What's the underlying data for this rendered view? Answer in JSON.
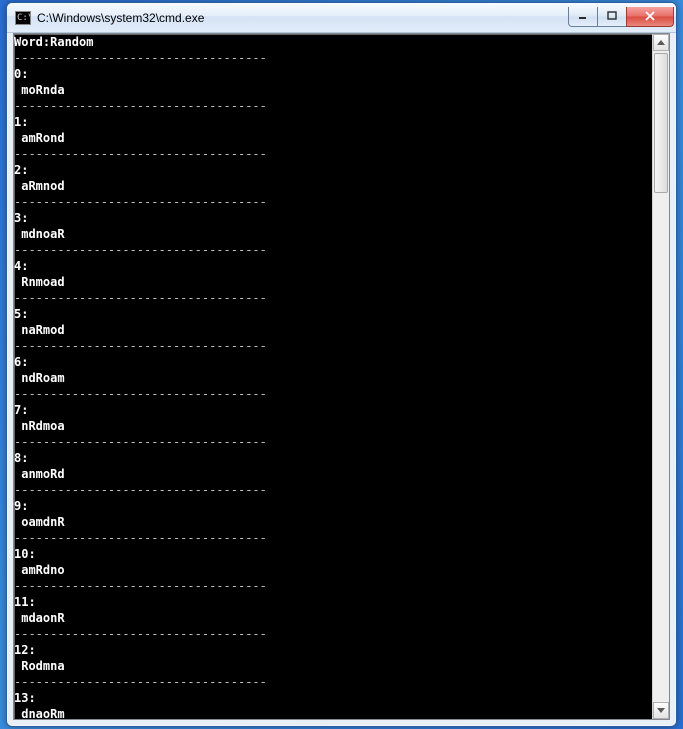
{
  "window": {
    "title": "C:\\Windows\\system32\\cmd.exe",
    "icon_glyph": "C:\\"
  },
  "console": {
    "header": "Word:Random",
    "dash": "-----------------------------------",
    "entries": [
      {
        "idx": "0",
        "word": "moRnda"
      },
      {
        "idx": "1",
        "word": "amRond"
      },
      {
        "idx": "2",
        "word": "aRmnod"
      },
      {
        "idx": "3",
        "word": "mdnoaR"
      },
      {
        "idx": "4",
        "word": "Rnmoad"
      },
      {
        "idx": "5",
        "word": "naRmod"
      },
      {
        "idx": "6",
        "word": "ndRoam"
      },
      {
        "idx": "7",
        "word": "nRdmoa"
      },
      {
        "idx": "8",
        "word": "anmoRd"
      },
      {
        "idx": "9",
        "word": "oamdnR"
      },
      {
        "idx": "10",
        "word": "amRdno"
      },
      {
        "idx": "11",
        "word": "mdaonR"
      },
      {
        "idx": "12",
        "word": "Rodmna"
      },
      {
        "idx": "13",
        "word": "dnaoRm"
      }
    ]
  }
}
